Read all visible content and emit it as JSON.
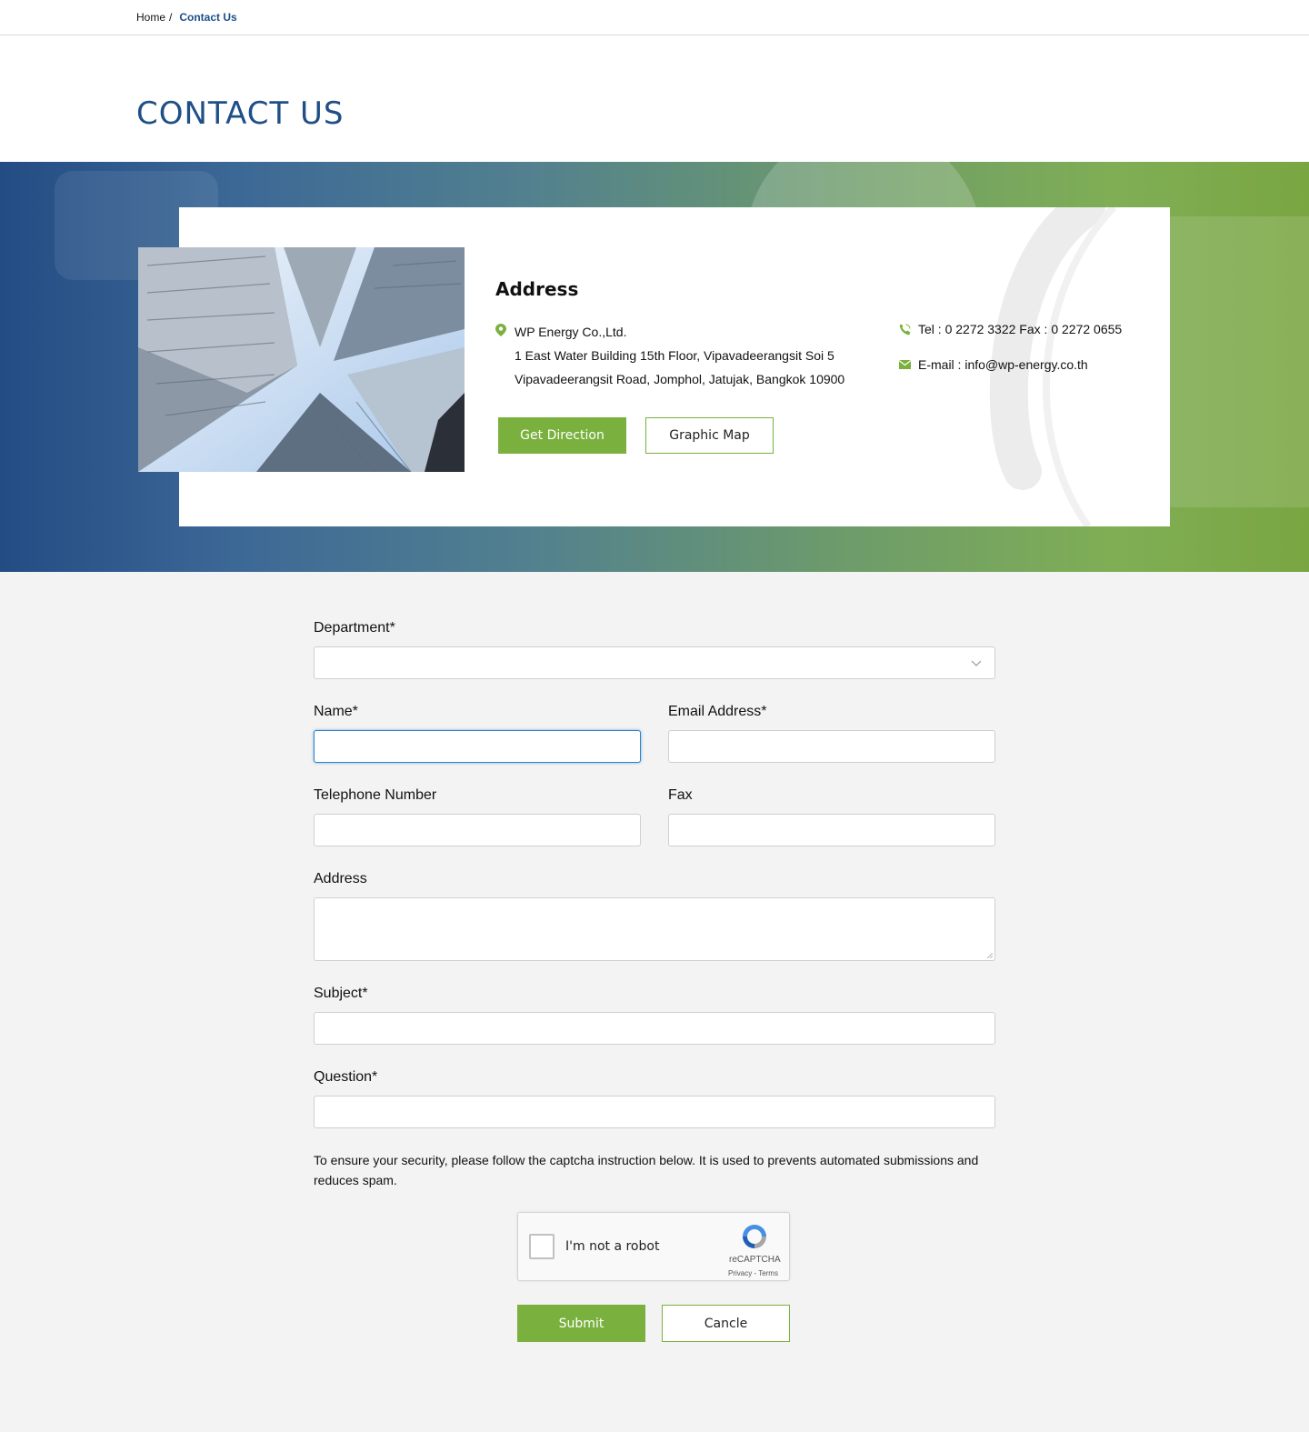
{
  "breadcrumb": {
    "home": "Home",
    "separator": "/",
    "current": "Contact Us"
  },
  "page_title": "CONTACT US",
  "address": {
    "heading": "Address",
    "company": "WP Energy Co.,Ltd.",
    "line1": "1 East Water Building 15th Floor, Vipavadeerangsit Soi 5",
    "line2": "Vipavadeerangsit Road, Jomphol, Jatujak, Bangkok 10900",
    "tel": "Tel : 0 2272 3322 Fax : 0 2272 0655",
    "email": "E-mail : info@wp-energy.co.th",
    "get_direction": "Get Direction",
    "graphic_map": "Graphic Map"
  },
  "form": {
    "department_label": "Department*",
    "department_value": "",
    "name_label": "Name*",
    "email_label": "Email Address*",
    "telephone_label": "Telephone Number",
    "fax_label": "Fax",
    "address_label": "Address",
    "subject_label": "Subject*",
    "question_label": "Question*",
    "security_note": "To ensure your security, please follow the captcha instruction below. It is used to prevents automated submissions and reduces spam.",
    "submit": "Submit",
    "cancel": "Cancle"
  },
  "captcha": {
    "label": "I'm not a robot",
    "brand": "reCAPTCHA",
    "links": "Privacy - Terms",
    "checked": false
  },
  "colors": {
    "brand_blue": "#1f4f86",
    "accent_green": "#7ab13e",
    "focus_blue": "#2d83c6",
    "page_bg": "#f3f3f3"
  },
  "icons": [
    "map-pin-icon",
    "phone-icon",
    "mail-icon",
    "chevron-down-icon",
    "recaptcha-logo-icon"
  ]
}
